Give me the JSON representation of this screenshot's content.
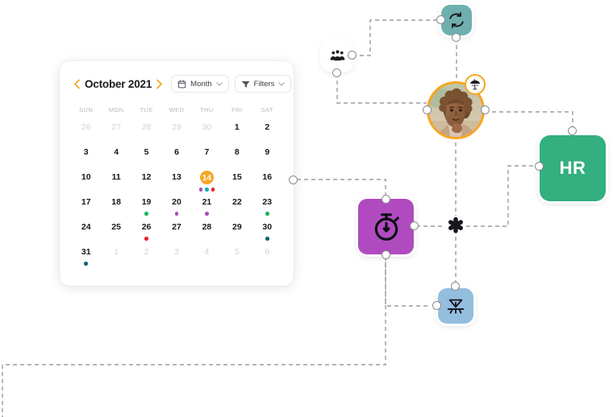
{
  "calendar": {
    "title": "October 2021",
    "prev_label": "‹",
    "next_label": "›",
    "view_button": {
      "label": "Month",
      "icon": "calendar-icon",
      "chevron": "chevron-down-icon"
    },
    "filters_button": {
      "label": "Filters",
      "icon": "funnel-icon",
      "chevron": "chevron-down-icon"
    },
    "weekdays": [
      "SUN",
      "MON",
      "TUE",
      "WED",
      "THU",
      "FRI",
      "SAT"
    ],
    "today": 14,
    "dot_colors": {
      "purple": "#B04BBF",
      "teal": "#12AEB5",
      "red": "#F01E2C",
      "green": "#18B85C",
      "navy": "#14627D"
    },
    "weeks": [
      [
        {
          "day": "26",
          "muted": true,
          "dots": []
        },
        {
          "day": "27",
          "muted": true,
          "dots": []
        },
        {
          "day": "28",
          "muted": true,
          "dots": []
        },
        {
          "day": "29",
          "muted": true,
          "dots": []
        },
        {
          "day": "30",
          "muted": true,
          "dots": []
        },
        {
          "day": "1",
          "muted": false,
          "dots": []
        },
        {
          "day": "2",
          "muted": false,
          "dots": []
        }
      ],
      [
        {
          "day": "3",
          "muted": false,
          "dots": []
        },
        {
          "day": "4",
          "muted": false,
          "dots": []
        },
        {
          "day": "5",
          "muted": false,
          "dots": []
        },
        {
          "day": "6",
          "muted": false,
          "dots": []
        },
        {
          "day": "7",
          "muted": false,
          "dots": []
        },
        {
          "day": "8",
          "muted": false,
          "dots": []
        },
        {
          "day": "9",
          "muted": false,
          "dots": []
        }
      ],
      [
        {
          "day": "10",
          "muted": false,
          "dots": []
        },
        {
          "day": "11",
          "muted": false,
          "dots": []
        },
        {
          "day": "12",
          "muted": false,
          "dots": []
        },
        {
          "day": "13",
          "muted": false,
          "dots": []
        },
        {
          "day": "14",
          "muted": false,
          "today": true,
          "dots": [
            "#B04BBF",
            "#12AEB5",
            "#F01E2C"
          ]
        },
        {
          "day": "15",
          "muted": false,
          "dots": []
        },
        {
          "day": "16",
          "muted": false,
          "dots": []
        }
      ],
      [
        {
          "day": "17",
          "muted": false,
          "dots": []
        },
        {
          "day": "18",
          "muted": false,
          "dots": []
        },
        {
          "day": "19",
          "muted": false,
          "dots": [
            "#18B85C"
          ]
        },
        {
          "day": "20",
          "muted": false,
          "dots": [
            "#B04BBF"
          ]
        },
        {
          "day": "21",
          "muted": false,
          "dots": [
            "#B04BBF"
          ]
        },
        {
          "day": "22",
          "muted": false,
          "dots": []
        },
        {
          "day": "23",
          "muted": false,
          "dots": [
            "#18B85C"
          ]
        }
      ],
      [
        {
          "day": "24",
          "muted": false,
          "dots": []
        },
        {
          "day": "25",
          "muted": false,
          "dots": []
        },
        {
          "day": "26",
          "muted": false,
          "dots": [
            "#F01E2C"
          ]
        },
        {
          "day": "27",
          "muted": false,
          "dots": []
        },
        {
          "day": "28",
          "muted": false,
          "dots": []
        },
        {
          "day": "29",
          "muted": false,
          "dots": []
        },
        {
          "day": "30",
          "muted": false,
          "dots": [
            "#14627D"
          ]
        }
      ],
      [
        {
          "day": "31",
          "muted": false,
          "dots": [
            "#14627D"
          ]
        },
        {
          "day": "1",
          "muted": true,
          "dots": []
        },
        {
          "day": "2",
          "muted": true,
          "dots": []
        },
        {
          "day": "3",
          "muted": true,
          "dots": []
        },
        {
          "day": "4",
          "muted": true,
          "dots": []
        },
        {
          "day": "5",
          "muted": true,
          "dots": []
        },
        {
          "day": "6",
          "muted": true,
          "dots": []
        }
      ]
    ]
  },
  "graph": {
    "nodes": {
      "team": {
        "icon": "people-group-icon",
        "color": "#F9B417",
        "label": ""
      },
      "sync": {
        "icon": "refresh-sync-icon",
        "color": "#6FAFB0",
        "label": ""
      },
      "person": {
        "icon": "avatar-photo",
        "ring_color": "#F5A623",
        "badge_icon": "beach-umbrella-icon",
        "label": ""
      },
      "hr": {
        "icon": "",
        "color": "#34AF7F",
        "label": "HR"
      },
      "timer": {
        "icon": "stopwatch-icon",
        "color": "#B04BBF",
        "label": ""
      },
      "junction": {
        "icon": "asterisk-icon",
        "color": "#1b1b1f",
        "label": ""
      },
      "filter": {
        "icon": "funnel-collapse-icon",
        "color": "#94BEDE",
        "label": ""
      }
    },
    "edge_color": "#9b9ba3"
  }
}
